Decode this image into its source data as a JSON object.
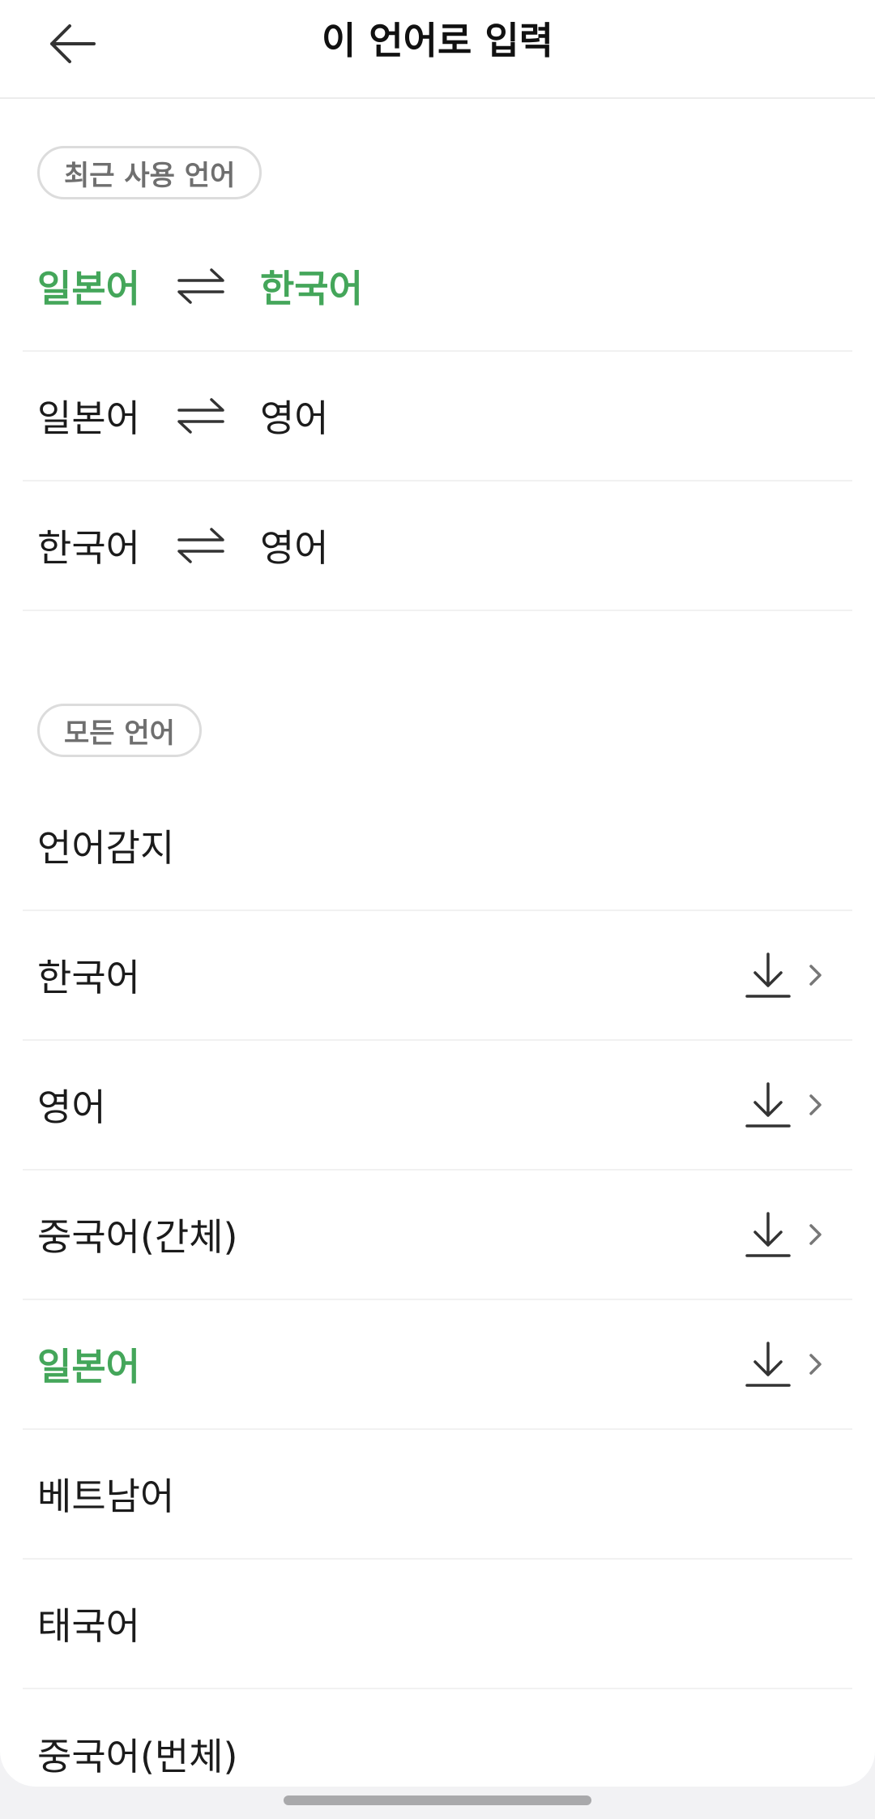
{
  "header": {
    "title": "이 언어로 입력",
    "back_icon": "arrow-left-icon"
  },
  "recent": {
    "chip_label": "최근 사용 언어",
    "pairs": [
      {
        "from": "일본어",
        "to": "한국어",
        "selected": true
      },
      {
        "from": "일본어",
        "to": "영어",
        "selected": false
      },
      {
        "from": "한국어",
        "to": "영어",
        "selected": false
      }
    ],
    "swap_icon": "swap-arrows-icon"
  },
  "all": {
    "chip_label": "모든 언어",
    "languages": [
      {
        "label": "언어감지",
        "download": false,
        "selected": false
      },
      {
        "label": "한국어",
        "download": true,
        "selected": false
      },
      {
        "label": "영어",
        "download": true,
        "selected": false
      },
      {
        "label": "중국어(간체)",
        "download": true,
        "selected": false
      },
      {
        "label": "일본어",
        "download": true,
        "selected": true
      },
      {
        "label": "베트남어",
        "download": false,
        "selected": false
      },
      {
        "label": "태국어",
        "download": false,
        "selected": false
      },
      {
        "label": "중국어(번체)",
        "download": false,
        "selected": false
      }
    ],
    "download_icon": "download-icon",
    "chevron_icon": "chevron-right-icon"
  },
  "colors": {
    "accent": "#44a65a",
    "text": "#1b1b1b",
    "chip_text": "#6f6f6f",
    "divider": "#f1f1f1"
  }
}
